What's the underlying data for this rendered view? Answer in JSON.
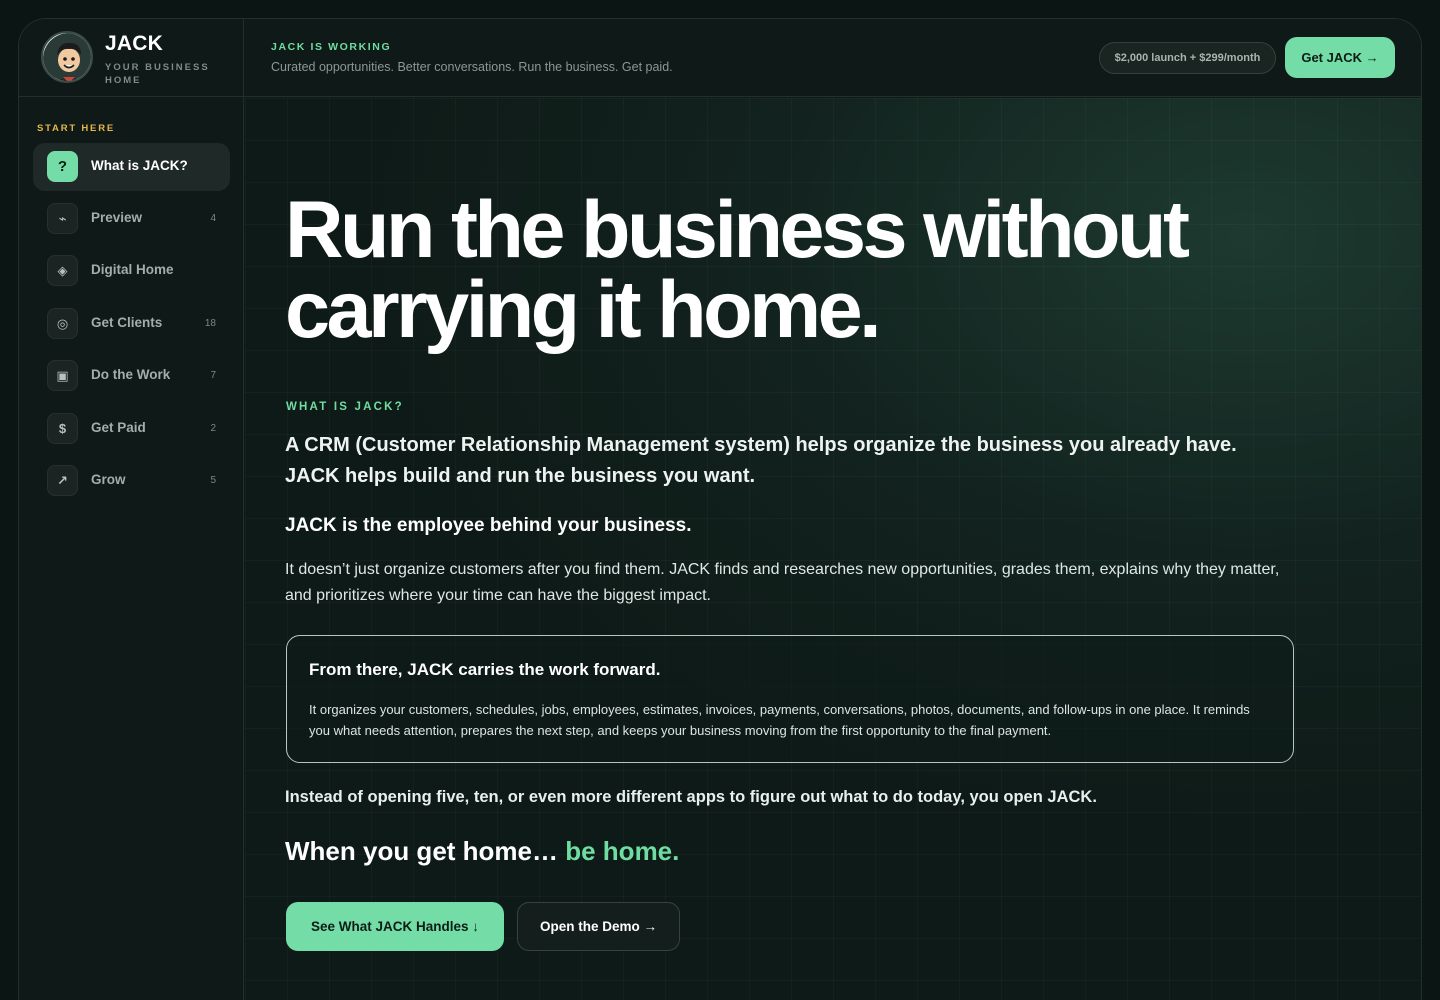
{
  "brand": {
    "name": "JACK",
    "subtitle": "YOUR BUSINESS HOME"
  },
  "header": {
    "status_label": "JACK IS WORKING",
    "status_text": "Curated opportunities. Better conversations. Run the business. Get paid.",
    "price": "$2,000 launch + $299/month",
    "cta_label": "Get JACK →"
  },
  "sidebar": {
    "heading": "START HERE",
    "items": [
      {
        "label": "What is JACK?",
        "count": "",
        "icon": "question-icon",
        "glyph": "?"
      },
      {
        "label": "Preview",
        "count": "4",
        "icon": "pulse-icon",
        "glyph": "⌁"
      },
      {
        "label": "Digital Home",
        "count": "",
        "icon": "diamond-icon",
        "glyph": "◈"
      },
      {
        "label": "Get Clients",
        "count": "18",
        "icon": "target-icon",
        "glyph": "◎"
      },
      {
        "label": "Do the Work",
        "count": "7",
        "icon": "square-icon",
        "glyph": "▣"
      },
      {
        "label": "Get Paid",
        "count": "2",
        "icon": "dollar-icon",
        "glyph": "$"
      },
      {
        "label": "Grow",
        "count": "5",
        "icon": "arrow-up-right-icon",
        "glyph": "↗"
      }
    ]
  },
  "main": {
    "hero_line1": "Run the business without",
    "hero_line2": "carrying it home.",
    "section_label": "WHAT IS JACK?",
    "intro_line1": "A CRM (Customer Relationship Management system) helps organize the business you already have.",
    "intro_line2": "JACK helps build and run the business you want.",
    "subhead": "JACK is the employee behind your business.",
    "paragraph": "It doesn’t just organize customers after you find them. JACK finds and researches new opportunities, grades them, explains why they matter, and prioritizes where your time can have the biggest impact.",
    "card_title": "From there, JACK carries the work forward.",
    "card_body": "It organizes your customers, schedules, jobs, employees, estimates, invoices, payments, conversations, photos, documents, and follow-ups in one place. It reminds you what needs attention, prepares the next step, and keeps your business moving from the first opportunity to the final payment.",
    "instead": "Instead of opening five, ten, or even more different apps to figure out what to do today, you open JACK.",
    "tagline_start": "When you get home…",
    "tagline_accent": "be home.",
    "primary_button": "See What JACK Handles ↓",
    "secondary_button": "Open the Demo →"
  },
  "colors": {
    "accent": "#74dca6",
    "background": "#0f1a18",
    "label_gold": "#e6b648"
  }
}
